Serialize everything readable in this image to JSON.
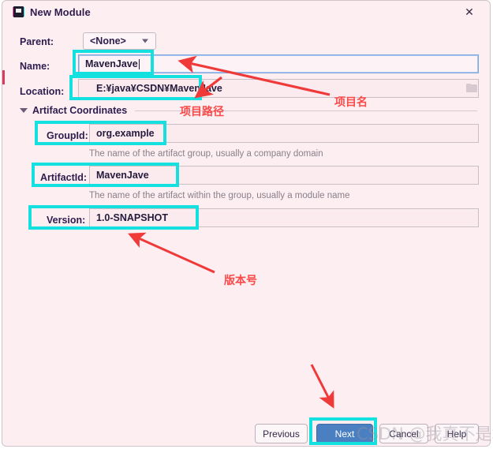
{
  "window": {
    "title": "New Module",
    "app_icon": "intellij-module-icon",
    "close_label": "✕",
    "background_color": "#fceef1"
  },
  "form": {
    "parent": {
      "label": "Parent:",
      "value": "<None>",
      "options": [
        "<None>"
      ]
    },
    "name": {
      "label": "Name:",
      "value": "MavenJave",
      "focused": true
    },
    "location": {
      "label": "Location:",
      "value": "E:¥java¥CSDN¥MavenJave",
      "browse_icon": "folder-icon"
    },
    "section": {
      "label": "Artifact Coordinates",
      "expanded": true
    },
    "group_id": {
      "label": "GroupId:",
      "value": "org.example",
      "hint": "The name of the artifact group, usually a company domain"
    },
    "artifact_id": {
      "label": "ArtifactId:",
      "value": "MavenJave",
      "hint": "The name of the artifact within the group, usually a module name"
    },
    "version": {
      "label": "Version:",
      "value": "1.0-SNAPSHOT"
    }
  },
  "buttons": {
    "previous": "Previous",
    "next": "Next",
    "cancel": "Cancel",
    "help": "Help"
  },
  "annotations": {
    "accent_color": "#14e0e0",
    "arrow_color": "#fa4a4a",
    "labels": [
      {
        "text": "项目名",
        "meaning": "project-name"
      },
      {
        "text": "项目路径",
        "meaning": "project-path"
      },
      {
        "text": "版本号",
        "meaning": "version-number"
      }
    ]
  },
  "watermark": {
    "text": "CSDN @我真不是城哥"
  }
}
